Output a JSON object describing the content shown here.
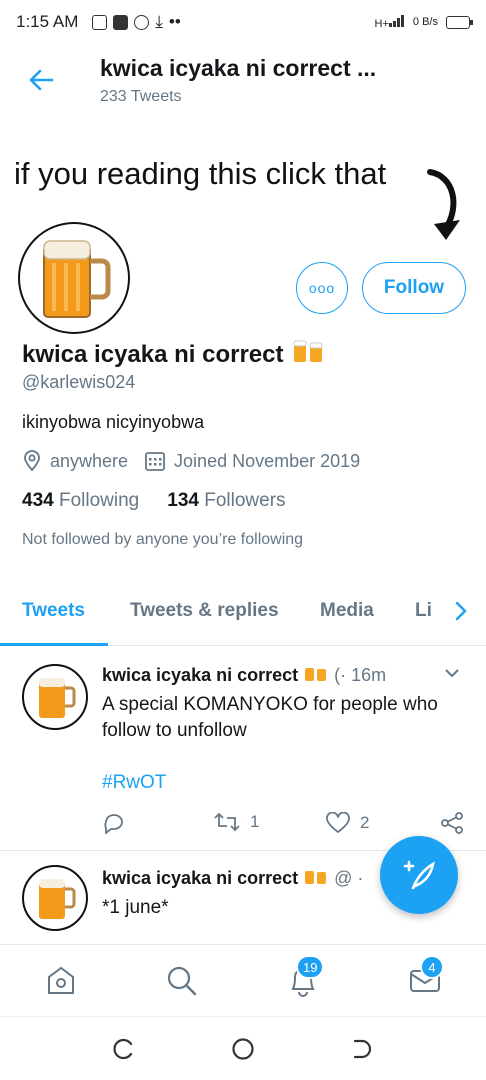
{
  "statusbar": {
    "time": "1:15 AM",
    "signal": "H+",
    "net_speed": "0 B/s"
  },
  "header": {
    "title": "kwica icyaka ni correct ...",
    "tweet_count": "233 Tweets",
    "back_icon": "arrow-left-icon"
  },
  "banner": {
    "text": "if you reading this click that"
  },
  "profile": {
    "name": "kwica icyaka ni correct",
    "emoji": "beer-mugs-icon",
    "handle": "@karlewis024",
    "bio": "ikinyobwa nicyinyobwa",
    "location": "anywhere",
    "joined": "Joined November 2019",
    "following_count": "434",
    "following_label": "Following",
    "followers_count": "134",
    "followers_label": "Followers",
    "not_followed": "Not followed by anyone you’re following",
    "more_label": "ooo",
    "follow_label": "Follow"
  },
  "tabs": [
    {
      "label": "Tweets",
      "active": true
    },
    {
      "label": "Tweets & replies"
    },
    {
      "label": "Media"
    },
    {
      "label": "Li"
    }
  ],
  "tweets": [
    {
      "name": "kwica icyaka ni correct",
      "meta": "(· 16m",
      "text": "A special KOMANYOKO for people who follow to unfollow",
      "hashtag": "#RwOT",
      "reply_count": "",
      "retweet_count": "1",
      "like_count": "2"
    },
    {
      "name": "kwica icyaka ni correct",
      "meta": "@ ·",
      "text": "*1 june*"
    }
  ],
  "bottomnav": {
    "notifications_badge": "19",
    "messages_badge": "4"
  },
  "colors": {
    "accent": "#1da1f2",
    "secondary_text": "#657786",
    "border": "#e1e8ed"
  }
}
